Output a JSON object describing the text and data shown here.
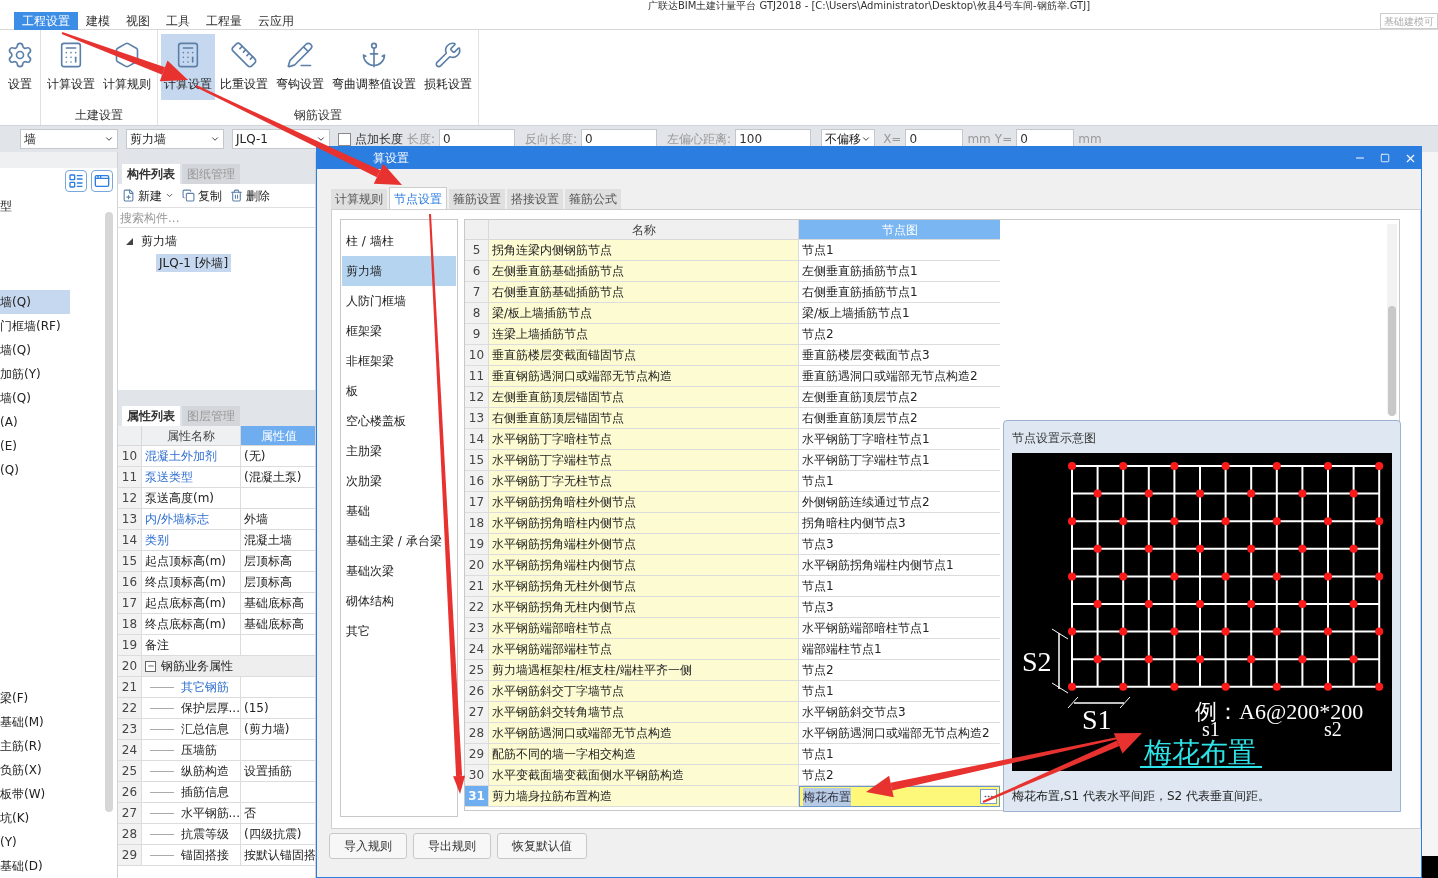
{
  "title_bar": {
    "title": "广联达BIM土建计量平台 GTJ2018 - [C:\\Users\\Administrator\\Desktop\\攸县4号车间-钢筋举.GTJ]",
    "mode_button": "基础建模可"
  },
  "menu": [
    {
      "label": "工程设置",
      "selected": true
    },
    {
      "label": "建模",
      "selected": false
    },
    {
      "label": "视图",
      "selected": false
    },
    {
      "label": "工具",
      "selected": false
    },
    {
      "label": "工程量",
      "selected": false
    },
    {
      "label": "云应用",
      "selected": false
    }
  ],
  "ribbon": [
    {
      "buttons": [
        {
          "label": "设置",
          "selected": false
        }
      ]
    },
    {
      "label": "土建设置",
      "buttons": [
        {
          "label": "计算设置",
          "selected": false
        },
        {
          "label": "计算规则",
          "selected": false
        }
      ]
    },
    {
      "label": "钢筋设置",
      "buttons": [
        {
          "label": "计算设置",
          "selected": true
        },
        {
          "label": "比重设置",
          "selected": false
        },
        {
          "label": "弯钩设置",
          "selected": false
        },
        {
          "label": "弯曲调整值设置",
          "selected": false
        },
        {
          "label": "损耗设置",
          "selected": false
        }
      ]
    }
  ],
  "toolbar": [
    {
      "kind": "select",
      "value": "墙"
    },
    {
      "kind": "select",
      "value": "剪力墙"
    },
    {
      "kind": "select",
      "value": "JLQ-1"
    },
    {
      "kind": "checkbox",
      "label": "点加长度",
      "checked": false
    },
    {
      "kind": "label",
      "text": "长度:"
    },
    {
      "kind": "input",
      "value": "0"
    },
    {
      "kind": "label",
      "text": "反向长度:"
    },
    {
      "kind": "input",
      "value": "0"
    },
    {
      "kind": "label",
      "text": "左偏心距离:"
    },
    {
      "kind": "input",
      "value": "100"
    },
    {
      "kind": "select",
      "value": "不偏移"
    },
    {
      "kind": "label",
      "text": "X="
    },
    {
      "kind": "spin",
      "value": "0"
    },
    {
      "kind": "label",
      "text": "mm"
    },
    {
      "kind": "label",
      "text": "Y="
    },
    {
      "kind": "spin",
      "value": "0"
    },
    {
      "kind": "label",
      "text": "mm"
    }
  ],
  "nav_panel": {
    "upper": [
      {
        "label": "型",
        "selected": false
      },
      {
        "label": "墙(Q)",
        "selected": true
      },
      {
        "label": "门框墙(RF)",
        "selected": false
      },
      {
        "label": "墙(Q)",
        "selected": false
      },
      {
        "label": "加筋(Y)",
        "selected": false
      },
      {
        "label": "墙(Q)",
        "selected": false
      },
      {
        "label": "(A)",
        "selected": false
      },
      {
        "label": "(E)",
        "selected": false
      },
      {
        "label": "(Q)",
        "selected": false
      }
    ],
    "lower": [
      {
        "label": "梁(F)",
        "selected": false
      },
      {
        "label": "基础(M)",
        "selected": false
      },
      {
        "label": "主筋(R)",
        "selected": false
      },
      {
        "label": "负筋(X)",
        "selected": false
      },
      {
        "label": "板带(W)",
        "selected": false
      },
      {
        "label": "坑(K)",
        "selected": false
      },
      {
        "label": "(Y)",
        "selected": false
      },
      {
        "label": "基础(D)",
        "selected": false
      }
    ]
  },
  "component_panel": {
    "tabs": [
      {
        "label": "构件列表",
        "selected": true
      },
      {
        "label": "图纸管理",
        "selected": false
      }
    ],
    "actions": [
      "新建",
      "复制",
      "删除"
    ],
    "search": {
      "placeholder": "搜索构件..."
    },
    "tree": [
      {
        "label": "剪力墙",
        "expanded": true,
        "selected": false,
        "children": [
          {
            "label": "JLQ-1 [外墙]",
            "selected": true
          }
        ]
      }
    ]
  },
  "property_panel": {
    "tabs": [
      {
        "label": "属性列表",
        "selected": true
      },
      {
        "label": "图层管理",
        "selected": false
      }
    ],
    "columns": [
      "属性名称",
      "属性值"
    ],
    "rows": [
      {
        "kind": "plain",
        "num": "10",
        "name": "混凝土外加剂",
        "value": "(无)",
        "linked": true
      },
      {
        "kind": "plain",
        "num": "11",
        "name": "泵送类型",
        "value": "(混凝土泵)",
        "linked": true
      },
      {
        "kind": "plain",
        "num": "12",
        "name": "泵送高度(m)",
        "linked": false
      },
      {
        "kind": "plain",
        "num": "13",
        "name": "内/外墙标志",
        "value": "外墙",
        "linked": true
      },
      {
        "kind": "plain",
        "num": "14",
        "name": "类别",
        "value": "混凝土墙",
        "linked": true
      },
      {
        "kind": "plain",
        "num": "15",
        "name": "起点顶标高(m)",
        "value": "层顶标高",
        "linked": false
      },
      {
        "kind": "plain",
        "num": "16",
        "name": "终点顶标高(m)",
        "value": "层顶标高",
        "linked": false
      },
      {
        "kind": "plain",
        "num": "17",
        "name": "起点底标高(m)",
        "value": "基础底标高",
        "linked": false
      },
      {
        "kind": "plain",
        "num": "18",
        "name": "终点底标高(m)",
        "value": "基础底标高",
        "linked": false
      },
      {
        "kind": "plain",
        "num": "19",
        "name": "备注",
        "linked": false
      },
      {
        "kind": "group",
        "num": "20",
        "name": "钢筋业务属性",
        "expanded": true,
        "linked": false
      },
      {
        "kind": "child",
        "num": "21",
        "name": "其它钢筋",
        "linked": true
      },
      {
        "kind": "child",
        "num": "22",
        "name": "保护层厚...",
        "value": "(15)",
        "linked": false
      },
      {
        "kind": "child",
        "num": "23",
        "name": "汇总信息",
        "value": "(剪力墙)",
        "linked": false
      },
      {
        "kind": "child",
        "num": "24",
        "name": "压墙筋",
        "linked": false
      },
      {
        "kind": "child",
        "num": "25",
        "name": "纵筋构造",
        "value": "设置插筋",
        "linked": false
      },
      {
        "kind": "child",
        "num": "26",
        "name": "插筋信息",
        "linked": false
      },
      {
        "kind": "child",
        "num": "27",
        "name": "水平钢筋...",
        "value": "否",
        "linked": false
      },
      {
        "kind": "child",
        "num": "28",
        "name": "抗震等级",
        "value": "(四级抗震)",
        "linked": false
      },
      {
        "kind": "child",
        "num": "29",
        "name": "锚固搭接",
        "value": "按默认锚固搭",
        "linked": false
      }
    ]
  },
  "dialog": {
    "title": "算设置",
    "tabs": [
      {
        "label": "计算规则",
        "selected": false
      },
      {
        "label": "节点设置",
        "selected": true
      },
      {
        "label": "箍筋设置",
        "selected": false
      },
      {
        "label": "搭接设置",
        "selected": false
      },
      {
        "label": "箍筋公式",
        "selected": false
      }
    ],
    "categories": [
      {
        "label": "柱 / 墙柱",
        "selected": false
      },
      {
        "label": "剪力墙",
        "selected": true
      },
      {
        "label": "人防门框墙",
        "selected": false
      },
      {
        "label": "框架梁",
        "selected": false
      },
      {
        "label": "非框架梁",
        "selected": false
      },
      {
        "label": "板",
        "selected": false
      },
      {
        "label": "空心楼盖板",
        "selected": false
      },
      {
        "label": "主肋梁",
        "selected": false
      },
      {
        "label": "次肋梁",
        "selected": false
      },
      {
        "label": "基础",
        "selected": false
      },
      {
        "label": "基础主梁 / 承台梁",
        "selected": false
      },
      {
        "label": "基础次梁",
        "selected": false
      },
      {
        "label": "砌体结构",
        "selected": false
      },
      {
        "label": "其它",
        "selected": false
      }
    ],
    "columns": [
      "名称",
      "节点图"
    ],
    "rows": [
      {
        "num": "5",
        "name": "拐角连梁内侧钢筋节点",
        "value": "节点1",
        "selected": false
      },
      {
        "num": "6",
        "name": "左侧垂直筋基础插筋节点",
        "value": "左侧垂直筋插筋节点1",
        "selected": false
      },
      {
        "num": "7",
        "name": "右侧垂直筋基础插筋节点",
        "value": "右侧垂直筋插筋节点1",
        "selected": false
      },
      {
        "num": "8",
        "name": "梁/板上墙插筋节点",
        "value": "梁/板上墙插筋节点1",
        "selected": false
      },
      {
        "num": "9",
        "name": "连梁上墙插筋节点",
        "value": "节点2",
        "selected": false
      },
      {
        "num": "10",
        "name": "垂直筋楼层变截面锚固节点",
        "value": "垂直筋楼层变截面节点3",
        "selected": false
      },
      {
        "num": "11",
        "name": "垂直钢筋遇洞口或端部无节点构造",
        "value": "垂直筋遇洞口或端部无节点构造2",
        "selected": false
      },
      {
        "num": "12",
        "name": "左侧垂直筋顶层锚固节点",
        "value": "左侧垂直筋顶层节点2",
        "selected": false
      },
      {
        "num": "13",
        "name": "右侧垂直筋顶层锚固节点",
        "value": "右侧垂直筋顶层节点2",
        "selected": false
      },
      {
        "num": "14",
        "name": "水平钢筋丁字暗柱节点",
        "value": "水平钢筋丁字暗柱节点1",
        "selected": false
      },
      {
        "num": "15",
        "name": "水平钢筋丁字端柱节点",
        "value": "水平钢筋丁字端柱节点1",
        "selected": false
      },
      {
        "num": "16",
        "name": "水平钢筋丁字无柱节点",
        "value": "节点1",
        "selected": false
      },
      {
        "num": "17",
        "name": "水平钢筋拐角暗柱外侧节点",
        "value": "外侧钢筋连续通过节点2",
        "selected": false
      },
      {
        "num": "18",
        "name": "水平钢筋拐角暗柱内侧节点",
        "value": "拐角暗柱内侧节点3",
        "selected": false
      },
      {
        "num": "19",
        "name": "水平钢筋拐角端柱外侧节点",
        "value": "节点3",
        "selected": false
      },
      {
        "num": "20",
        "name": "水平钢筋拐角端柱内侧节点",
        "value": "水平钢筋拐角端柱内侧节点1",
        "selected": false
      },
      {
        "num": "21",
        "name": "水平钢筋拐角无柱外侧节点",
        "value": "节点1",
        "selected": false
      },
      {
        "num": "22",
        "name": "水平钢筋拐角无柱内侧节点",
        "value": "节点3",
        "selected": false
      },
      {
        "num": "23",
        "name": "水平钢筋端部暗柱节点",
        "value": "水平钢筋端部暗柱节点1",
        "selected": false
      },
      {
        "num": "24",
        "name": "水平钢筋端部端柱节点",
        "value": "端部端柱节点1",
        "selected": false
      },
      {
        "num": "25",
        "name": "剪力墙遇框架柱/框支柱/端柱平齐一侧",
        "value": "节点2",
        "selected": false
      },
      {
        "num": "26",
        "name": "水平钢筋斜交丁字墙节点",
        "value": "节点1",
        "selected": false
      },
      {
        "num": "27",
        "name": "水平钢筋斜交转角墙节点",
        "value": "水平钢筋斜交节点3",
        "selected": false
      },
      {
        "num": "28",
        "name": "水平钢筋遇洞口或端部无节点构造",
        "value": "水平钢筋遇洞口或端部无节点构造2",
        "selected": false
      },
      {
        "num": "29",
        "name": "配筋不同的墙一字相交构造",
        "value": "节点1",
        "selected": false
      },
      {
        "num": "30",
        "name": "水平变截面墙变截面侧水平钢筋构造",
        "value": "节点2",
        "selected": false
      },
      {
        "num": "31",
        "name": "剪力墙身拉筋布置构造",
        "value": "梅花布置",
        "selected": true
      }
    ],
    "node_preview": {
      "title": "节点设置示意图",
      "labels": {
        "s2_dim": "S2",
        "s1_dim": "S1",
        "example": "例：A6@200*200",
        "s1": "s1",
        "s2": "s2",
        "layout": "梅花布置"
      },
      "description": "梅花布置,S1 代表水平间距，S2 代表垂直间距。"
    },
    "buttons": [
      "导入规则",
      "导出规则",
      "恢复默认值"
    ]
  }
}
